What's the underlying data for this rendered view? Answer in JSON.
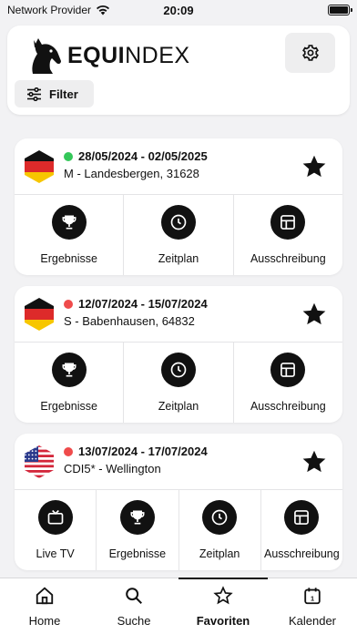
{
  "status_bar": {
    "carrier": "Network Provider",
    "time": "20:09",
    "battery_level": 1.0
  },
  "header": {
    "logo_bold": "EQUI",
    "logo_light": "NDEX",
    "filter_label": "Filter"
  },
  "events": [
    {
      "flag": "germany",
      "status_color": "#34c759",
      "dates": "28/05/2024 - 02/05/2025",
      "location": "M - Landesbergen, 31628",
      "favorite": true,
      "actions": [
        {
          "label": "Ergebnisse",
          "icon": "trophy-icon"
        },
        {
          "label": "Zeitplan",
          "icon": "clock-icon"
        },
        {
          "label": "Ausschreibung",
          "icon": "grid-icon"
        }
      ]
    },
    {
      "flag": "germany",
      "status_color": "#ef4b4b",
      "dates": "12/07/2024 - 15/07/2024",
      "location": "S - Babenhausen, 64832",
      "favorite": true,
      "actions": [
        {
          "label": "Ergebnisse",
          "icon": "trophy-icon"
        },
        {
          "label": "Zeitplan",
          "icon": "clock-icon"
        },
        {
          "label": "Ausschreibung",
          "icon": "grid-icon"
        }
      ]
    },
    {
      "flag": "usa",
      "status_color": "#ef4b4b",
      "dates": "13/07/2024 - 17/07/2024",
      "location": "CDI5* - Wellington",
      "favorite": true,
      "actions": [
        {
          "label": "Live TV",
          "icon": "tv-icon"
        },
        {
          "label": "Ergebnisse",
          "icon": "trophy-icon"
        },
        {
          "label": "Zeitplan",
          "icon": "clock-icon"
        },
        {
          "label": "Ausschreibung",
          "icon": "grid-icon"
        }
      ]
    }
  ],
  "tabs": [
    {
      "label": "Home",
      "icon": "home-icon",
      "active": false
    },
    {
      "label": "Suche",
      "icon": "search-icon",
      "active": false
    },
    {
      "label": "Favoriten",
      "icon": "star-icon",
      "active": true
    },
    {
      "label": "Kalender",
      "icon": "calendar-icon",
      "active": false
    }
  ]
}
